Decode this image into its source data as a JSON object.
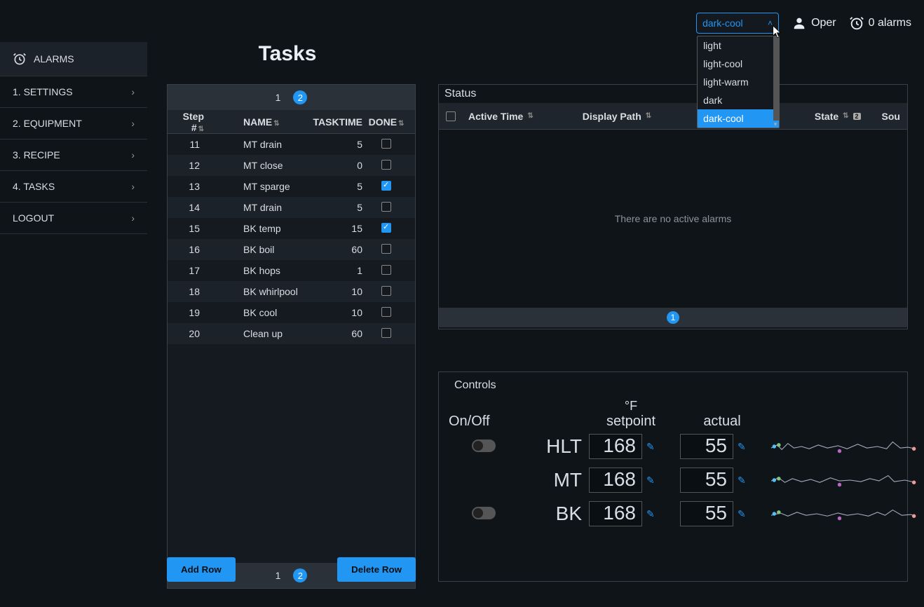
{
  "topbar": {
    "theme_selected": "dark-cool",
    "theme_options": [
      "light",
      "light-cool",
      "light-warm",
      "dark",
      "dark-cool"
    ],
    "user_label": "Oper",
    "alarms_label": "0 alarms"
  },
  "sidebar": {
    "header": "ALARMS",
    "items": [
      {
        "label": "1. SETTINGS"
      },
      {
        "label": "2. EQUIPMENT"
      },
      {
        "label": "3. RECIPE"
      },
      {
        "label": "4. TASKS"
      },
      {
        "label": "LOGOUT"
      }
    ]
  },
  "tasks": {
    "title": "Tasks",
    "pages": [
      "1",
      "2"
    ],
    "active_page": "2",
    "headers": {
      "step": "Step #",
      "name": "NAME",
      "time": "TASKTIME",
      "done": "DONE"
    },
    "rows": [
      {
        "step": "11",
        "name": "MT drain",
        "time": "5",
        "done": false
      },
      {
        "step": "12",
        "name": "MT close",
        "time": "0",
        "done": false
      },
      {
        "step": "13",
        "name": "MT sparge",
        "time": "5",
        "done": true
      },
      {
        "step": "14",
        "name": "MT drain",
        "time": "5",
        "done": false
      },
      {
        "step": "15",
        "name": "BK temp",
        "time": "15",
        "done": true
      },
      {
        "step": "16",
        "name": "BK boil",
        "time": "60",
        "done": false
      },
      {
        "step": "17",
        "name": "BK hops",
        "time": "1",
        "done": false
      },
      {
        "step": "18",
        "name": "BK whirlpool",
        "time": "10",
        "done": false
      },
      {
        "step": "19",
        "name": "BK cool",
        "time": "10",
        "done": false
      },
      {
        "step": "20",
        "name": "Clean up",
        "time": "60",
        "done": false
      }
    ],
    "add_label": "Add Row",
    "delete_label": "Delete Row"
  },
  "status": {
    "title": "Status",
    "headers": {
      "active": "Active Time",
      "path": "Display Path",
      "state": "State",
      "state_badge": "2",
      "source": "Sou"
    },
    "empty": "There are no active alarms",
    "page": "1"
  },
  "controls": {
    "title": "Controls",
    "unit": "°F",
    "head": {
      "onoff": "On/Off",
      "setpoint": "setpoint",
      "actual": "actual"
    },
    "rows": [
      {
        "label": "HLT",
        "setpoint": "168",
        "actual": "55",
        "toggle": true
      },
      {
        "label": "MT",
        "setpoint": "168",
        "actual": "55",
        "toggle": false
      },
      {
        "label": "BK",
        "setpoint": "168",
        "actual": "55",
        "toggle": true
      }
    ]
  }
}
